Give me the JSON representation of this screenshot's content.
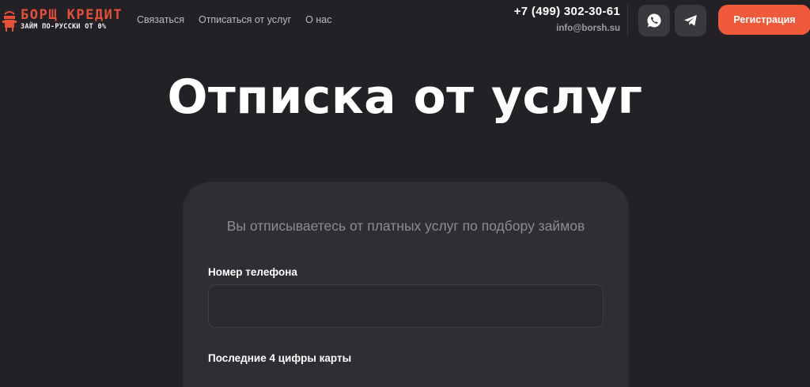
{
  "header": {
    "logo": {
      "title": "БОРЩ КРЕДИТ",
      "subtitle": "ЗАЙМ ПО-РУССКИ ОТ 0%",
      "accent_color": "#e4503a"
    },
    "nav": [
      {
        "label": "Связаться"
      },
      {
        "label": "Отписаться от услуг"
      },
      {
        "label": "О нас"
      }
    ],
    "contacts": {
      "phone": "+7 (499) 302-30-61",
      "email": "info@borsh.su"
    },
    "social": [
      {
        "icon": "whatsapp-icon"
      },
      {
        "icon": "telegram-icon"
      }
    ],
    "register_label": "Регистрация",
    "register_color": "#ef5a3b"
  },
  "main": {
    "title": "Отписка от услуг",
    "card": {
      "subtitle": "Вы отписываетесь от платных услуг по подбору займов",
      "fields": [
        {
          "label": "Номер телефона",
          "value": "",
          "placeholder": ""
        },
        {
          "label": "Последние 4 цифры карты"
        }
      ]
    }
  },
  "colors": {
    "background": "#232126",
    "card": "#2f2e33"
  }
}
